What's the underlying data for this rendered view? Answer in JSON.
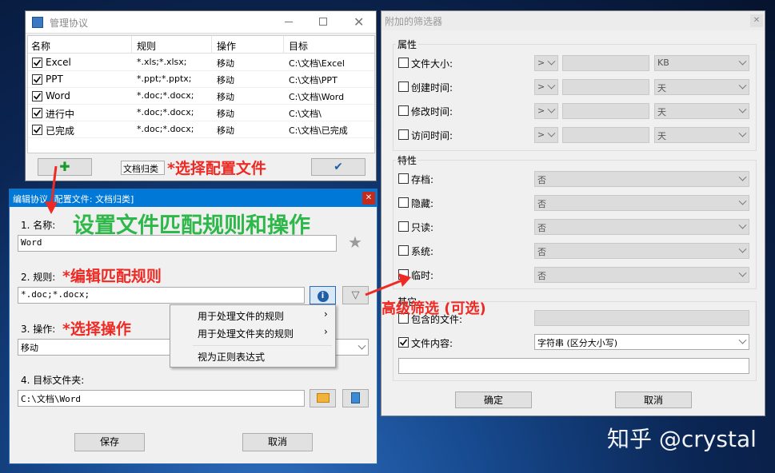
{
  "manage_window": {
    "title": "管理协议",
    "columns": [
      "名称",
      "规则",
      "操作",
      "目标"
    ],
    "rows": [
      {
        "name": "Excel",
        "rule": "*.xls;*.xlsx;",
        "action": "移动",
        "target": "C:\\文档\\Excel"
      },
      {
        "name": "PPT",
        "rule": "*.ppt;*.pptx;",
        "action": "移动",
        "target": "C:\\文档\\PPT"
      },
      {
        "name": "Word",
        "rule": "*.doc;*.docx;",
        "action": "移动",
        "target": "C:\\文档\\Word"
      },
      {
        "name": "进行中",
        "rule": "*.doc;*.docx;",
        "action": "移动",
        "target": "C:\\文档\\"
      },
      {
        "name": "已完成",
        "rule": "*.doc;*.docx;",
        "action": "移动",
        "target": "C:\\文档\\已完成"
      }
    ],
    "profile_label": "文档归类"
  },
  "edit_window": {
    "title": "编辑协议 [配置文件: 文档归类]",
    "name_label": "1. 名称:",
    "name_value": "Word",
    "rule_label": "2. 规则:",
    "rule_value": "*.doc;*.docx;",
    "action_label": "3. 操作:",
    "action_value": "移动",
    "target_label": "4. 目标文件夹:",
    "target_value": "C:\\文档\\Word",
    "save": "保存",
    "cancel": "取消",
    "context_menu": [
      "用于处理文件的规则",
      "用于处理文件夹的规则",
      "视为正则表达式"
    ]
  },
  "filter_window": {
    "title": "附加的筛选器",
    "attributes_group": "属性",
    "attributes": [
      {
        "label": "文件大小:",
        "op": ">",
        "unit": "KB"
      },
      {
        "label": "创建时间:",
        "op": ">",
        "unit": "天"
      },
      {
        "label": "修改时间:",
        "op": ">",
        "unit": "天"
      },
      {
        "label": "访问时间:",
        "op": ">",
        "unit": "天"
      }
    ],
    "properties_group": "特性",
    "properties": [
      {
        "label": "存档:",
        "value": "否"
      },
      {
        "label": "隐藏:",
        "value": "否"
      },
      {
        "label": "只读:",
        "value": "否"
      },
      {
        "label": "系统:",
        "value": "否"
      },
      {
        "label": "临时:",
        "value": "否"
      }
    ],
    "other_group": "其它",
    "contains_files_label": "包含的文件:",
    "file_content_label": "文件内容:",
    "file_content_mode": "字符串 (区分大小写)",
    "ok": "确定",
    "cancel": "取消"
  },
  "annotations": {
    "choose_profile": "*选择配置文件",
    "set_rules": "设置文件匹配规则和操作",
    "edit_rule": "*编辑匹配规则",
    "choose_action": "*选择操作",
    "advanced_filter": "高级筛选 (可选)"
  },
  "watermark": "知乎 @crystal",
  "colors": {
    "annotation_red": "#ee2a24",
    "annotation_green": "#2fb84a",
    "titlebar_blue": "#0078d7",
    "close_red": "#c42b1c"
  }
}
